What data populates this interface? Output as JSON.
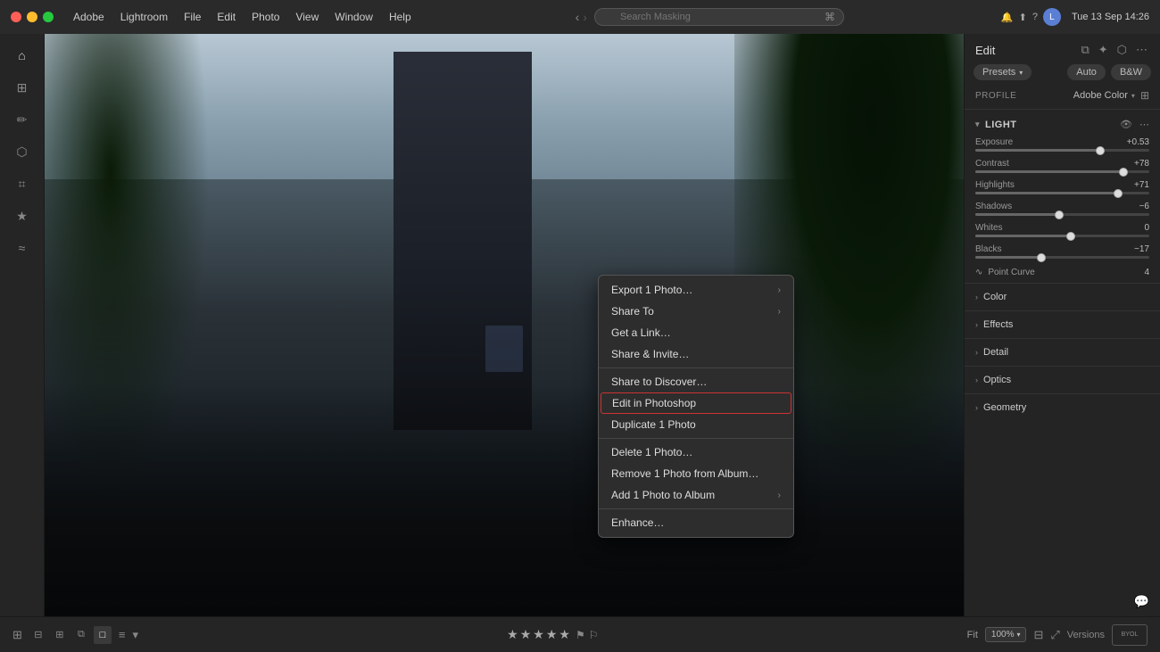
{
  "app": {
    "name": "Adobe Lightroom",
    "menu": [
      "Adobe",
      "Lightroom",
      "File",
      "Edit",
      "Photo",
      "View",
      "Window",
      "Help"
    ]
  },
  "titlebar": {
    "time": "Tue 13 Sep 14:26",
    "search_placeholder": "Search Masking"
  },
  "context_menu": {
    "items": [
      {
        "id": "export",
        "label": "Export 1 Photo…",
        "has_arrow": true
      },
      {
        "id": "share_to",
        "label": "Share To",
        "has_arrow": true
      },
      {
        "id": "get_link",
        "label": "Get a Link…",
        "has_arrow": false
      },
      {
        "id": "share_invite",
        "label": "Share & Invite…",
        "has_arrow": false
      },
      {
        "id": "sep1",
        "type": "separator"
      },
      {
        "id": "discover",
        "label": "Share to Discover…",
        "has_arrow": false
      },
      {
        "id": "edit_ps",
        "label": "Edit in Photoshop",
        "has_arrow": false,
        "highlighted": true
      },
      {
        "id": "duplicate",
        "label": "Duplicate 1 Photo",
        "has_arrow": false
      },
      {
        "id": "sep2",
        "type": "separator"
      },
      {
        "id": "delete",
        "label": "Delete 1 Photo…",
        "has_arrow": false
      },
      {
        "id": "remove",
        "label": "Remove 1 Photo from Album…",
        "has_arrow": false
      },
      {
        "id": "add_album",
        "label": "Add 1 Photo to Album",
        "has_arrow": true
      },
      {
        "id": "sep3",
        "type": "separator"
      },
      {
        "id": "enhance",
        "label": "Enhance…",
        "has_arrow": false
      }
    ]
  },
  "right_panel": {
    "title": "Edit",
    "presets_label": "Presets",
    "auto_label": "Auto",
    "bw_label": "B&W",
    "profile_label": "Profile",
    "profile_value": "Adobe Color",
    "sections": {
      "light": {
        "label": "Light",
        "collapsed": false,
        "sliders": [
          {
            "name": "Exposure",
            "value": "+0.53",
            "pct": 72
          },
          {
            "name": "Contrast",
            "value": "+78",
            "pct": 85
          },
          {
            "name": "Highlights",
            "value": "+71",
            "pct": 82
          },
          {
            "name": "Shadows",
            "value": "−6",
            "pct": 48
          },
          {
            "name": "Whites",
            "value": "0",
            "pct": 55
          },
          {
            "name": "Blacks",
            "value": "−17",
            "pct": 38
          }
        ]
      },
      "point_curve": {
        "label": "Point Curve",
        "value": "4"
      },
      "color": {
        "label": "Color"
      },
      "effects": {
        "label": "Effects"
      },
      "detail": {
        "label": "Detail"
      },
      "optics": {
        "label": "Optics"
      },
      "geometry": {
        "label": "Geometry"
      }
    }
  },
  "bottom_toolbar": {
    "fit_label": "Fit",
    "fit_value": "100%",
    "versions_label": "Versions",
    "stars": [
      "★",
      "★",
      "★",
      "★",
      "★"
    ]
  }
}
